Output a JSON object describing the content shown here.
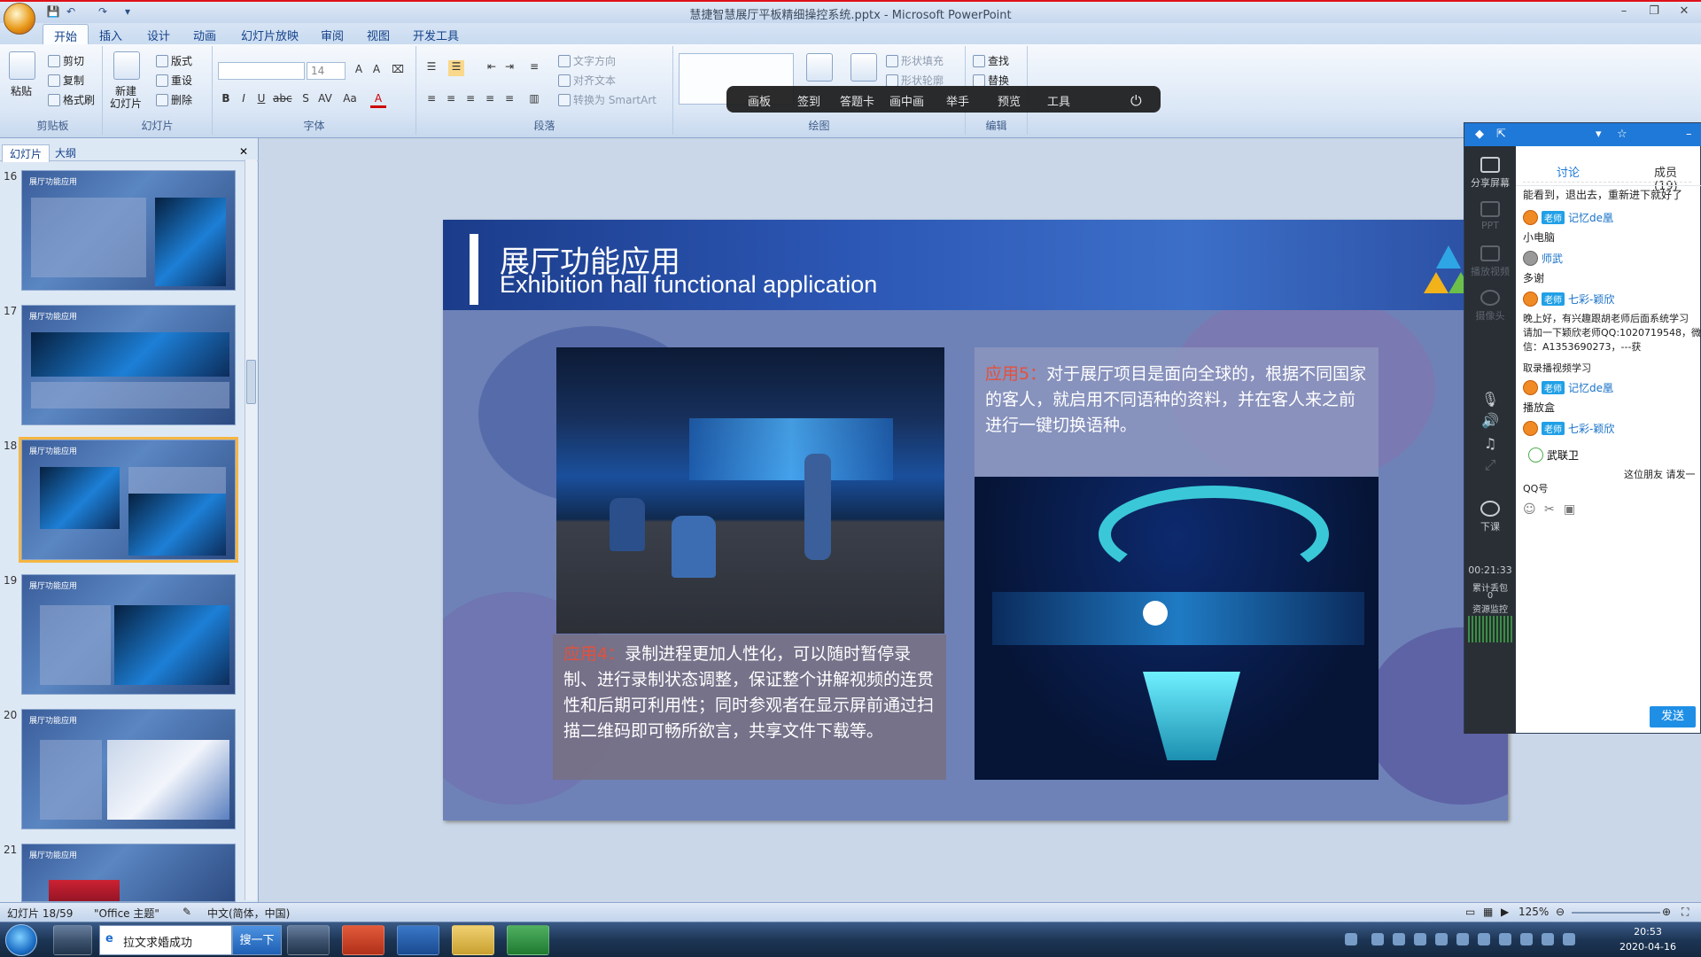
{
  "window": {
    "title": "慧捷智慧展厅平板精细操控系统.pptx - Microsoft PowerPoint"
  },
  "ribbon_tabs": [
    "开始",
    "插入",
    "设计",
    "动画",
    "幻灯片放映",
    "审阅",
    "视图",
    "开发工具"
  ],
  "ribbon": {
    "clipboard": {
      "label": "剪贴板",
      "paste": "粘贴",
      "cut": "剪切",
      "copy": "复制",
      "format_painter": "格式刷"
    },
    "slides": {
      "label": "幻灯片",
      "new_slide": "新建\n幻灯片",
      "layout": "版式",
      "reset": "重设",
      "delete": "删除"
    },
    "font": {
      "label": "字体",
      "size": "14"
    },
    "paragraph": {
      "label": "段落",
      "text_direction": "文字方向",
      "align_text": "对齐文本",
      "convert_smartart": "转换为 SmartArt"
    },
    "drawing": {
      "label": "绘图",
      "shape_fill": "形状填充",
      "shape_outline": "形状轮廓"
    },
    "editing": {
      "label": "编辑",
      "find": "查找",
      "replace": "替换"
    }
  },
  "overlay_toolbar": [
    "画板",
    "签到",
    "答题卡",
    "画中画",
    "举手",
    "预览",
    "工具"
  ],
  "left_pane": {
    "tabs": [
      "幻灯片",
      "大纲"
    ],
    "thumbs": [
      {
        "num": "16"
      },
      {
        "num": "17"
      },
      {
        "num": "18"
      },
      {
        "num": "19"
      },
      {
        "num": "20"
      },
      {
        "num": "21"
      }
    ],
    "thumb_title": "展厅功能应用",
    "thumb_sub": "Exhibition hall functional application"
  },
  "slide": {
    "title": "展厅功能应用",
    "subtitle": "Exhibition hall functional application",
    "box1_highlight": "应用4：",
    "box1_text": "录制进程更加人性化，可以随时暂停录制、进行录制状态调整，保证整个讲解视频的连贯性和后期可利用性；同时参观者在显示屏前通过扫描二维码即可畅所欲言，共享文件下载等。",
    "box2_highlight": "应用5：",
    "box2_text": "对于展厅项目是面向全球的，根据不同国家的客人，就启用不同语种的资料，并在客人来之前进行一键切换语种。"
  },
  "side_panel": {
    "side_items": [
      "分享屏幕",
      "PPT",
      "播放视频",
      "摄像头",
      "下课"
    ],
    "timer": "00:21:33",
    "stats": [
      "累计丢包",
      "0",
      "资源监控"
    ],
    "chat_tabs": [
      "讨论",
      "成员(19)"
    ],
    "messages": [
      {
        "text": "能看到，退出去，重新进下就好了"
      },
      {
        "tag": "老师",
        "user": "记忆de凰",
        "text": "小电脑"
      },
      {
        "user": "师武",
        "text": "多谢"
      },
      {
        "tag": "老师",
        "user": "七彩-颖欣",
        "text": "晚上好，有兴趣跟胡老师后面系统学习",
        "text2": "请加一下颖欣老师QQ:1020719548，微",
        "text3": "信：A1353690273，---获",
        "text4": "取录播视频学习"
      },
      {
        "tag": "老师",
        "user": "记忆de凰",
        "text": "播放盒"
      },
      {
        "tag": "老师",
        "user": "七彩-颖欣",
        "text": ""
      },
      {
        "user": "武联卫",
        "text": "这位朋友 请发一",
        "text2": "QQ号"
      }
    ],
    "send": "发送"
  },
  "status": {
    "slide_info": "幻灯片 18/59",
    "theme": "\"Office 主题\"",
    "lang": "中文(简体，中国)",
    "zoom": "125%"
  },
  "taskbar": {
    "ie_text": "拉文求婚成功",
    "search": "搜一下",
    "time": "20:53",
    "date": "2020-04-16"
  }
}
